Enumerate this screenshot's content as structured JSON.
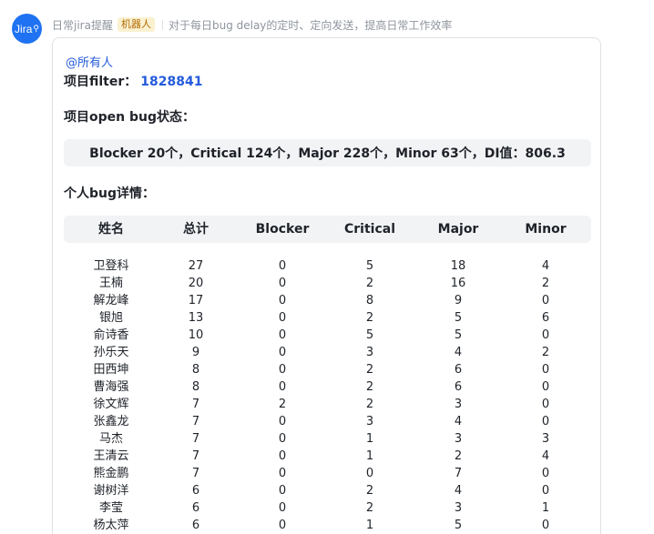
{
  "header": {
    "sender": "日常jira提醒",
    "bot_tag": "机器人",
    "description": "对于每日bug delay的定时、定向发送，提高日常工作效率",
    "avatar_label": "Jira"
  },
  "card": {
    "mention": "@所有人",
    "filter_label": "项目filter：",
    "filter_id": "1828841",
    "open_bug_title": "项目open bug状态：",
    "summary": "Blocker 20个，Critical 124个，Major 228个，Minor 63个，DI值：806.3",
    "detail_title": "个人bug详情：",
    "table": {
      "headers": [
        "姓名",
        "总计",
        "Blocker",
        "Critical",
        "Major",
        "Minor"
      ],
      "rows": [
        [
          "卫登科",
          "27",
          "0",
          "5",
          "18",
          "4"
        ],
        [
          "王楠",
          "20",
          "0",
          "2",
          "16",
          "2"
        ],
        [
          "解龙峰",
          "17",
          "0",
          "8",
          "9",
          "0"
        ],
        [
          "银旭",
          "13",
          "0",
          "2",
          "5",
          "6"
        ],
        [
          "俞诗香",
          "10",
          "0",
          "5",
          "5",
          "0"
        ],
        [
          "孙乐天",
          "9",
          "0",
          "3",
          "4",
          "2"
        ],
        [
          "田西坤",
          "8",
          "0",
          "2",
          "6",
          "0"
        ],
        [
          "曹海强",
          "8",
          "0",
          "2",
          "6",
          "0"
        ],
        [
          "徐文辉",
          "7",
          "2",
          "2",
          "3",
          "0"
        ],
        [
          "张鑫龙",
          "7",
          "0",
          "3",
          "4",
          "0"
        ],
        [
          "马杰",
          "7",
          "0",
          "1",
          "3",
          "3"
        ],
        [
          "王清云",
          "7",
          "0",
          "1",
          "2",
          "4"
        ],
        [
          "熊金鹏",
          "7",
          "0",
          "0",
          "7",
          "0"
        ],
        [
          "谢树洋",
          "6",
          "0",
          "2",
          "4",
          "0"
        ],
        [
          "李莹",
          "6",
          "0",
          "2",
          "3",
          "1"
        ],
        [
          "杨太萍",
          "6",
          "0",
          "1",
          "5",
          "0"
        ]
      ]
    }
  }
}
